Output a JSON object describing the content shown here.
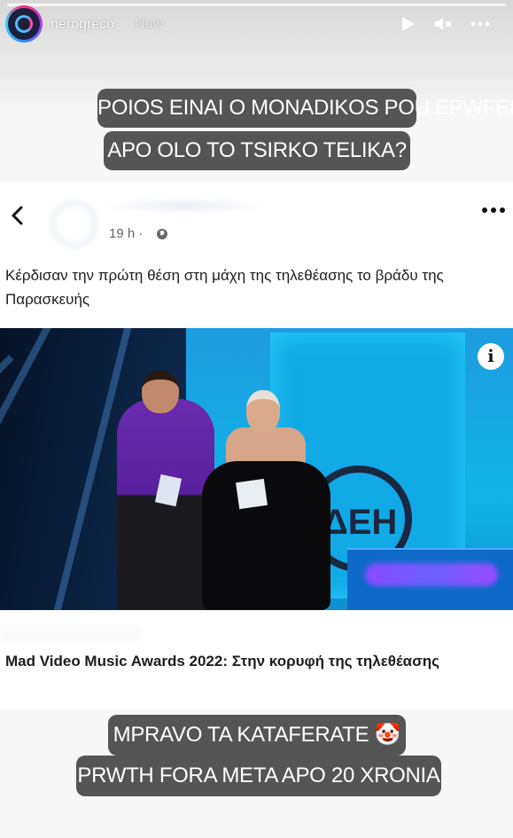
{
  "story": {
    "username": "nerogreco",
    "timestamp": "Now",
    "icons": [
      "play-icon",
      "mute-icon",
      "more-icon"
    ]
  },
  "captions": {
    "top_line1": "POIOS EINAI O MONADIKOS POU EPWFELITHIKE",
    "top_line2": "APO OLO TO TSIRKO TELIKA?",
    "bottom_line1": "MPRAVO TA KATAFERATE 🤡",
    "bottom_line2": "PRWTH FORA META APO 20 XRONIA"
  },
  "post": {
    "time": "19 h ·",
    "text": "Κέρδισαν την πρώτη θέση στη μάχη της τηλεθέασης το βράδυ της Παρασκευής",
    "info_label": "i",
    "link_title": "Mad Video Music Awards 2022: Στην κορυφή της τηλεθέασης",
    "screen_text": "ΔΕΗ"
  },
  "colors": {
    "caption_bg": "#555555",
    "post_bg": "#ffffff",
    "muted_text": "#65676b"
  }
}
